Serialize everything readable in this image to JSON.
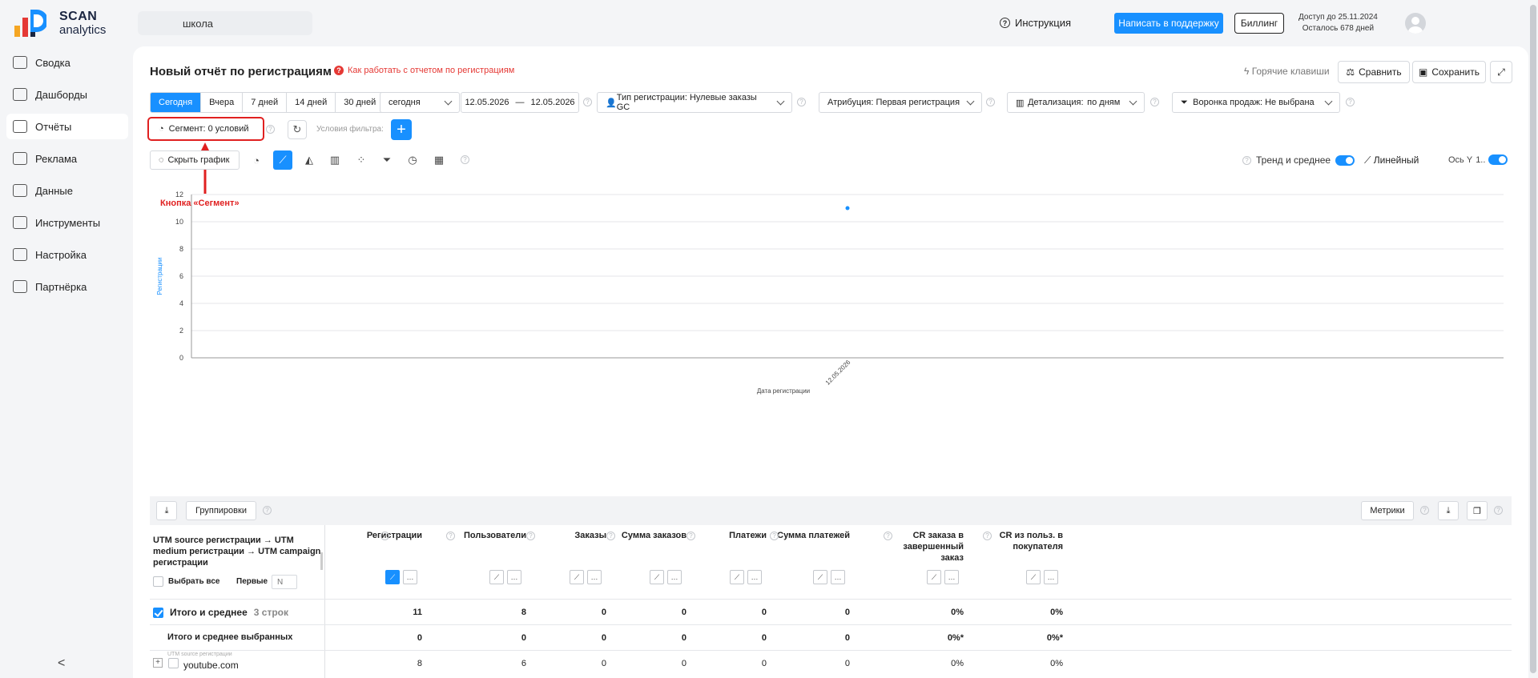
{
  "header": {
    "logo_line1": "SCAN",
    "logo_line2": "analytics",
    "search_value": "школа",
    "instruction_label": "Инструкция",
    "support_button": "Написать в поддержку",
    "billing_button": "Биллинг",
    "access_until": "Доступ до 25.11.2024",
    "days_left": "Осталось 678 дней"
  },
  "sidebar": {
    "items": [
      {
        "label": "Сводка",
        "icon": "summary-icon"
      },
      {
        "label": "Дашборды",
        "icon": "dashboard-icon"
      },
      {
        "label": "Отчёты",
        "icon": "reports-icon",
        "active": true
      },
      {
        "label": "Реклама",
        "icon": "ads-icon"
      },
      {
        "label": "Данные",
        "icon": "data-icon"
      },
      {
        "label": "Инструменты",
        "icon": "tools-icon"
      },
      {
        "label": "Настройка",
        "icon": "settings-icon"
      },
      {
        "label": "Партнёрка",
        "icon": "partners-icon"
      }
    ],
    "collapse_glyph": "<"
  },
  "report": {
    "title": "Новый отчёт по регистрациям",
    "howto_link": "Как работать с отчетом по регистрациям",
    "hotkeys": "Горячие клавиши",
    "compare": "Сравнить",
    "save": "Сохранить"
  },
  "filters": {
    "periods": [
      "Сегодня",
      "Вчера",
      "7 дней",
      "14 дней",
      "30 дней"
    ],
    "selected_period": "Сегодня",
    "period_dropdown": "сегодня",
    "date_from": "12.05.2026",
    "date_sep": "—",
    "date_to": "12.05.2026",
    "reg_type": "Тип регистрации: Нулевые заказы GC",
    "attribution": "Атрибуция: Первая регистрация",
    "detail_label": "Детализация:",
    "detail_value": "по дням",
    "funnel": "Воронка продаж: Не выбрана",
    "segment": "Сегмент: 0 условий",
    "filter_conditions": "Условия фильтра:"
  },
  "annotation": {
    "label": "Кнопка «Сегмент»",
    "color": "#e02020"
  },
  "chart_toolbar": {
    "hide_chart": "Скрыть график",
    "trend_label": "Тренд и среднее",
    "scale_label": "Линейный",
    "axis_y_label": "Ось Y",
    "axis_y_suffix": "1.."
  },
  "chart_data": {
    "type": "scatter",
    "x": [
      "12.05.2026"
    ],
    "series": [
      {
        "values": [
          11
        ]
      }
    ],
    "xlabel": "Дата регистрации",
    "ylabel": "Регистрации",
    "ylim": [
      0,
      12
    ],
    "yticks": [
      0,
      2,
      4,
      6,
      8,
      10,
      12
    ],
    "grid": true,
    "point_color": "#1890ff"
  },
  "table": {
    "groupings_button": "Группировки",
    "metrics_button": "Метрики",
    "dimension_header": "UTM source регистрации → UTM medium регистрации → UTM campaign регистрации",
    "select_all": "Выбрать все",
    "first_label": "Первые",
    "first_placeholder": "N",
    "columns": [
      "Регистрации",
      "Пользователи",
      "Заказы",
      "Сумма заказов",
      "Платежи",
      "Сумма платежей",
      "CR заказа в завершенный заказ",
      "CR из польз. в покупателя"
    ],
    "total_row": {
      "label": "Итого и среднее",
      "count": "3 строк",
      "values": [
        "11",
        "8",
        "0",
        "0",
        "0",
        "0",
        "0%",
        "0%"
      ]
    },
    "selected_total_row": {
      "label": "Итого и среднее выбранных",
      "values": [
        "0",
        "0",
        "0",
        "0",
        "0",
        "0",
        "0%*",
        "0%*"
      ]
    },
    "rows": [
      {
        "caption": "UTM source регистрации",
        "label": "youtube.com",
        "values": [
          "8",
          "6",
          "0",
          "0",
          "0",
          "0",
          "0%",
          "0%"
        ]
      }
    ]
  }
}
